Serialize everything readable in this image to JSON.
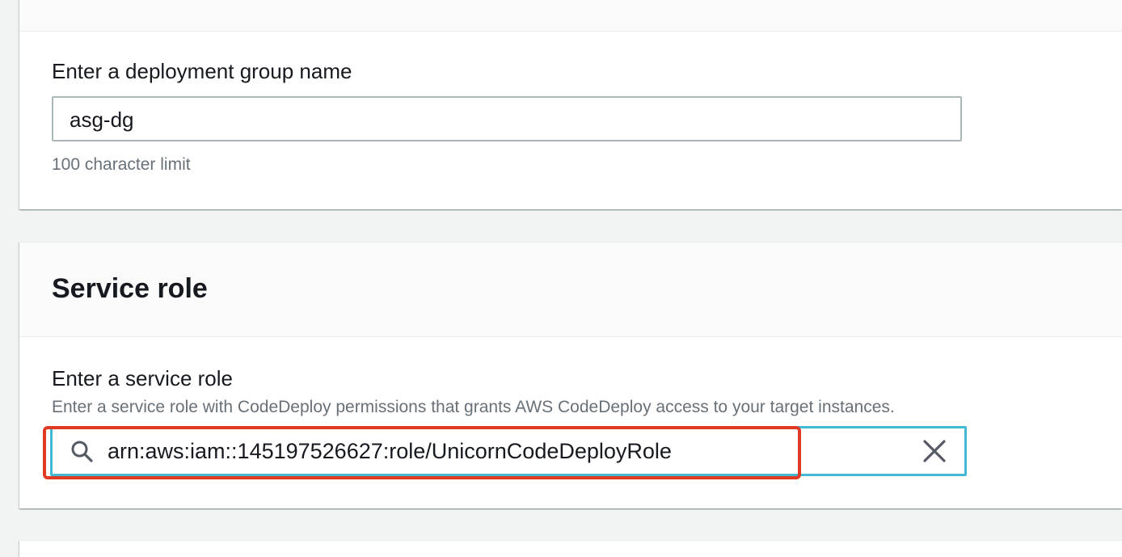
{
  "deployment_group": {
    "label": "Enter a deployment group name",
    "value": "asg-dg",
    "constraint": "100 character limit"
  },
  "service_role": {
    "section_title": "Service role",
    "label": "Enter a service role",
    "description": "Enter a service role with CodeDeploy permissions that grants AWS CodeDeploy access to your target instances.",
    "value": "arn:aws:iam::145197526627:role/UnicornCodeDeployRole",
    "search_icon": "search-icon",
    "clear_icon": "close-icon"
  },
  "colors": {
    "focus_border": "#44b9d6",
    "highlight": "#e03a25",
    "text": "#16191f",
    "muted_text": "#687078"
  }
}
